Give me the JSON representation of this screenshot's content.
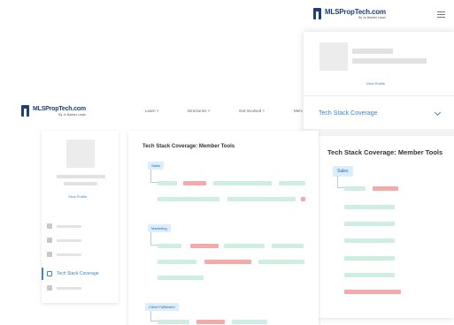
{
  "brand": {
    "name": "MLSPropTech.com",
    "tagline": "By Jo Banker Lewis"
  },
  "desktop": {
    "nav": [
      {
        "label": "Learn ˅"
      },
      {
        "label": "Directories ˅"
      },
      {
        "label": "Get Involved ˅"
      },
      {
        "label": "Mem"
      }
    ],
    "sidebar": {
      "view_profile": "View Profile",
      "active_item": "Tech Stack Coverage"
    },
    "main": {
      "title": "Tech Stack Coverage: Member Tools",
      "sections": [
        "Sales",
        "Marketing",
        "Client Fulfillment"
      ]
    }
  },
  "mobile": {
    "view_profile": "View Profile",
    "accordion_label": "Tech Stack Coverage",
    "title": "Tech Stack Coverage: Member Tools",
    "section": "Sales"
  },
  "colors": {
    "brand": "#1d3f7a",
    "accent": "#3a86c8",
    "covered": "#cdeee0",
    "gap": "#f2aaaa"
  }
}
